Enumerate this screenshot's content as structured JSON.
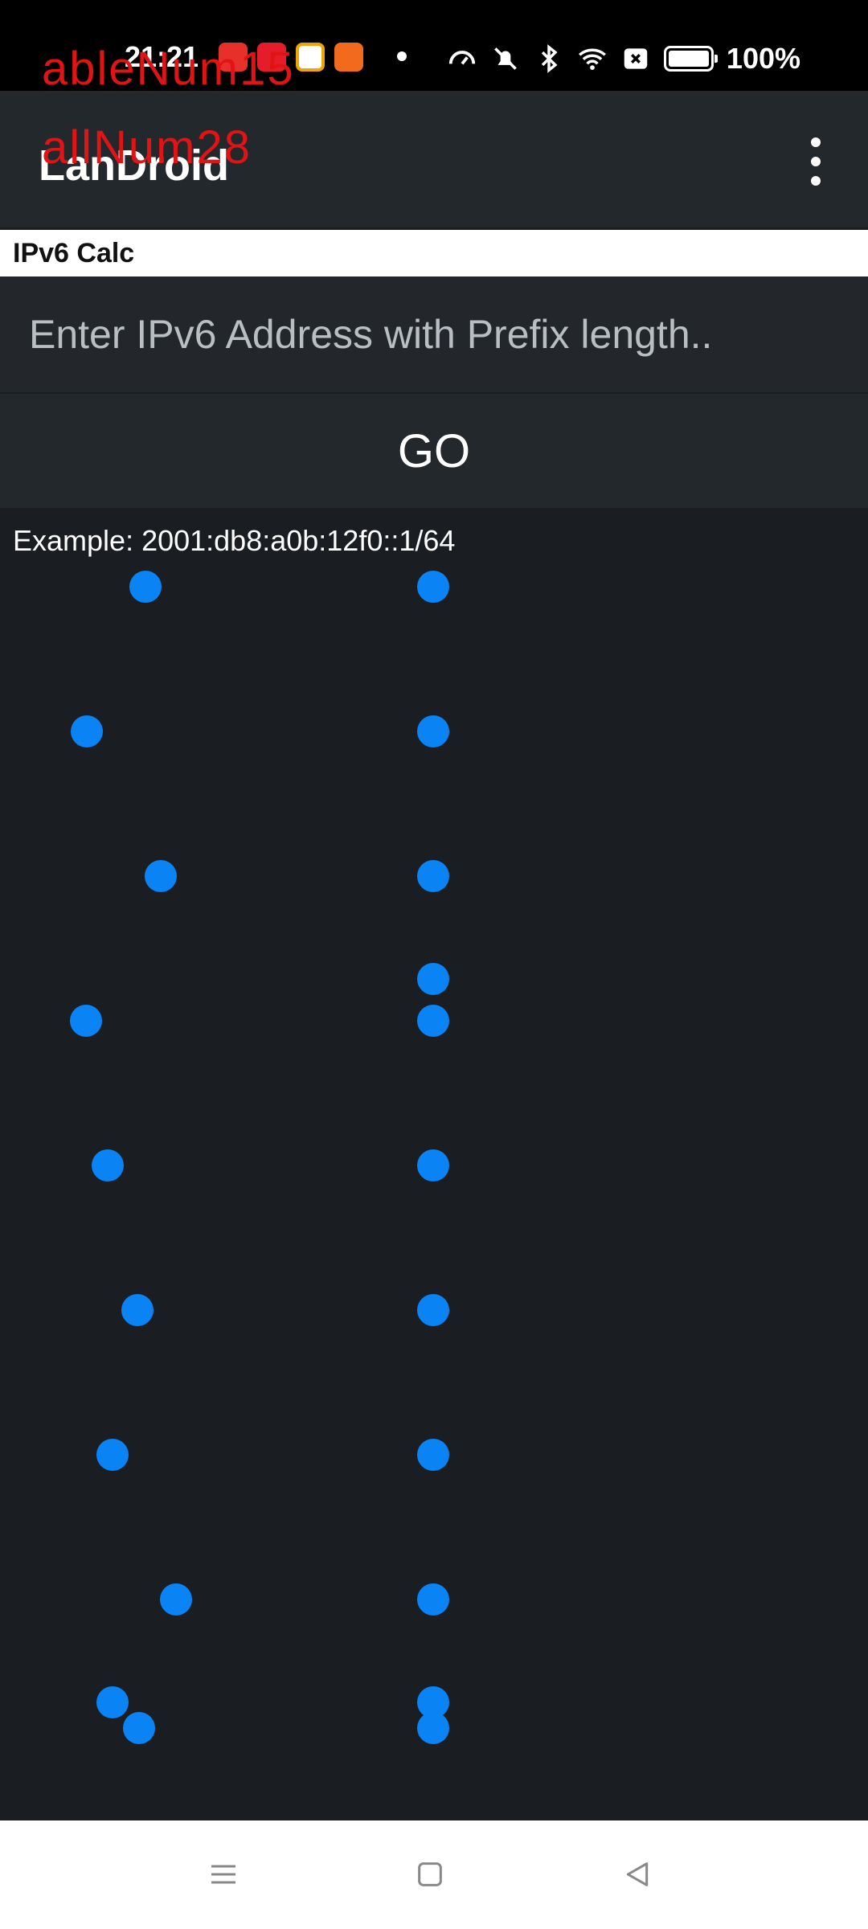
{
  "status_bar": {
    "time": "21:21",
    "battery": "100%",
    "icons": [
      "notification-app-icon",
      "notification-app-icon",
      "notification-app-icon",
      "notification-app-icon",
      "speedometer-icon",
      "bell-off-icon",
      "bluetooth-icon",
      "wifi-icon",
      "sim-off-icon",
      "battery-icon"
    ]
  },
  "overlay": {
    "line1": "ableNum15",
    "line2": "allNum28"
  },
  "app_bar": {
    "title": "LanDroid",
    "menu_icon": "more-vert-icon"
  },
  "section": {
    "title": "IPv6 Calc"
  },
  "form": {
    "placeholder": "Enter IPv6 Address with Prefix length..",
    "value": "",
    "go_label": "GO",
    "example": "Example: 2001:db8:a0b:12f0::1/64"
  },
  "colors": {
    "background": "#1a1d21",
    "app_bar": "#22282c",
    "touch_dot": "#0a84f5",
    "overlay_text": "#e01414"
  },
  "navigation": {
    "icons": [
      "menu-icon",
      "home-icon",
      "back-icon"
    ]
  }
}
